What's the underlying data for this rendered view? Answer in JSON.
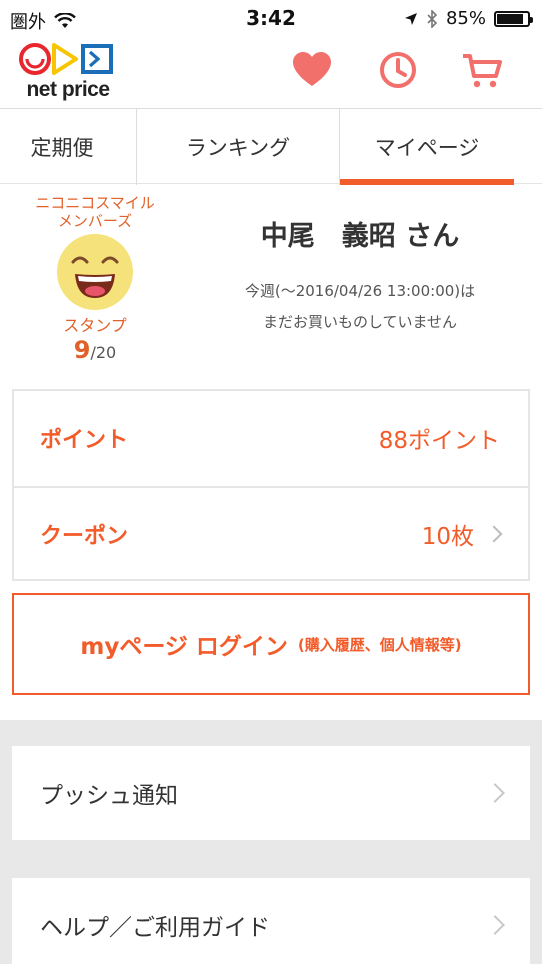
{
  "status_bar": {
    "carrier": "圏外",
    "time": "3:42",
    "battery": "85%"
  },
  "header": {
    "logo_text": "net price",
    "icons": [
      "heart-icon",
      "clock-icon",
      "cart-icon"
    ],
    "accent_color": "#f25c2a"
  },
  "tabs": [
    {
      "label": "定期便",
      "active": false
    },
    {
      "label": "ランキング",
      "active": false
    },
    {
      "label": "マイページ",
      "active": true
    }
  ],
  "profile": {
    "smile_title_line1": "ニコニコスマイル",
    "smile_title_line2": "メンバーズ",
    "stamp_label": "スタンプ",
    "stamp_count": "9",
    "stamp_total": "/20",
    "name": "中尾　義昭 さん",
    "week_line1": "今週(〜2016/04/26 13:00:00)は",
    "week_line2": "まだお買いものしていません"
  },
  "summary": {
    "points_label": "ポイント",
    "points_value": "88ポイント",
    "coupon_label": "クーポン",
    "coupon_value": "10枚"
  },
  "login": {
    "main": "myページ ログイン",
    "sub": "(購入履歴、個人情報等)"
  },
  "menu": [
    {
      "label": "プッシュ通知"
    },
    {
      "label": "ヘルプ／ご利用ガイド"
    }
  ]
}
